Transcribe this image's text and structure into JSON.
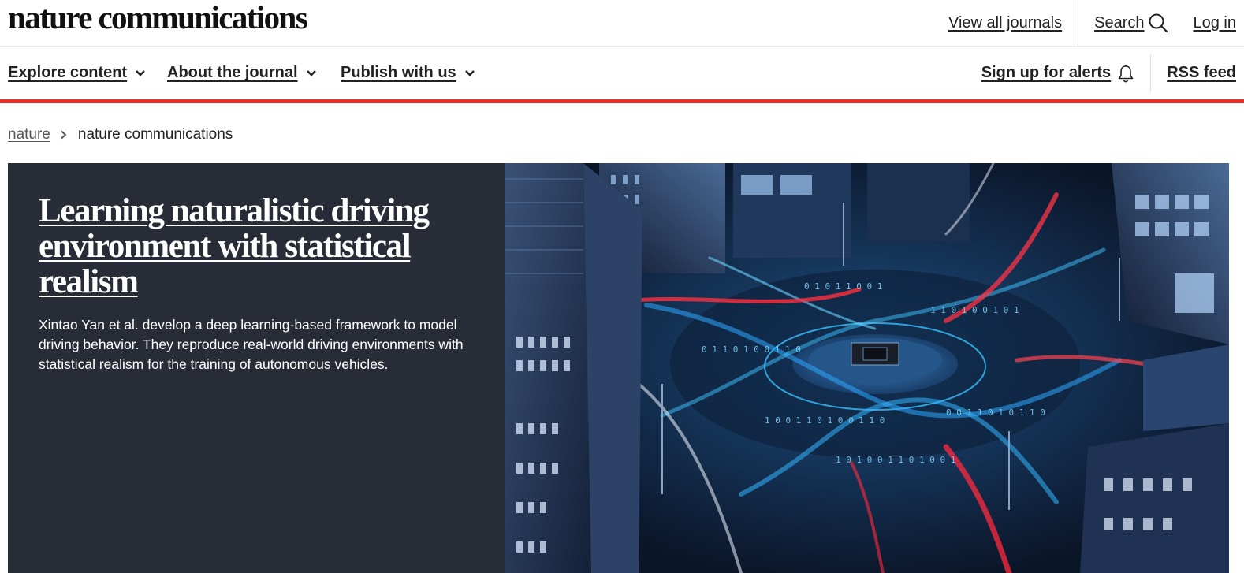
{
  "header": {
    "logo": "nature communications",
    "view_all_journals": "View all journals",
    "search_label": "Search",
    "login_label": "Log in"
  },
  "nav": {
    "explore": "Explore content",
    "about": "About the journal",
    "publish": "Publish with us",
    "alerts": "Sign up for alerts",
    "rss": "RSS feed"
  },
  "breadcrumb": {
    "root": "nature",
    "current": "nature communications"
  },
  "hero": {
    "title": "Learning naturalistic driving environment with statistical realism",
    "description": "Xintao Yan et al. develop a deep learning-based framework to model driving behavior. They reproduce real-world driving environments with statistical realism for the training of autonomous vehicles."
  },
  "colors": {
    "accent_red": "#e4302b",
    "hero_panel": "#282c36",
    "text": "#222222"
  },
  "icons": [
    "search-icon",
    "chevron-down-icon",
    "bell-icon",
    "chevron-right-icon"
  ]
}
